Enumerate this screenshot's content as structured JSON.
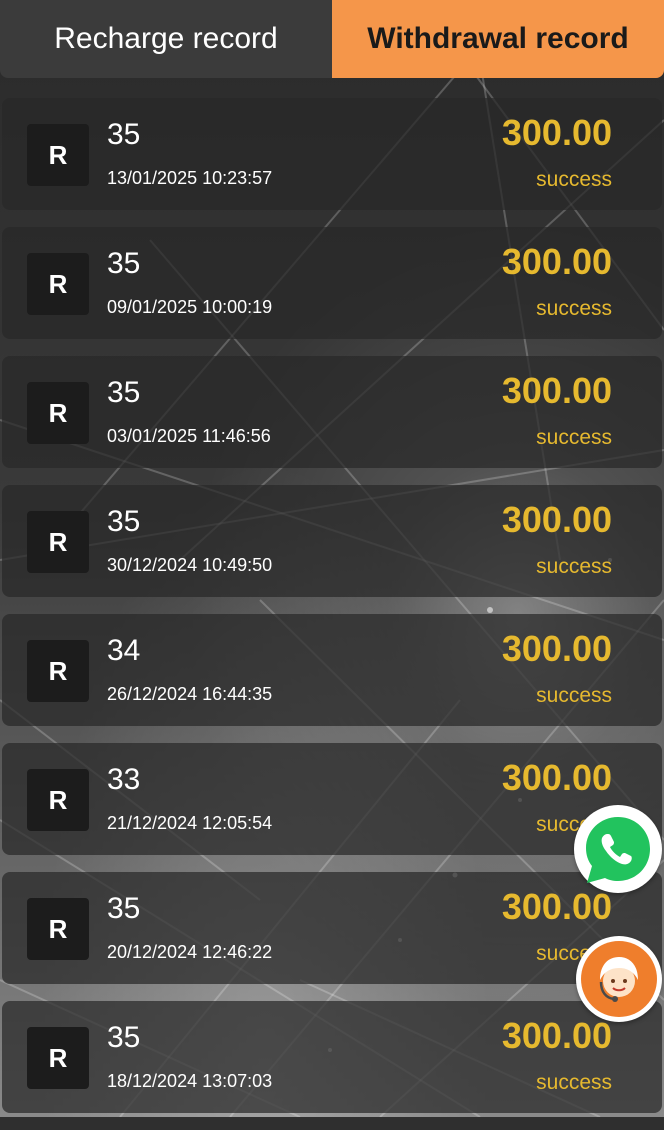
{
  "tabs": {
    "recharge_label": "Recharge record",
    "withdrawal_label": "Withdrawal record"
  },
  "records": [
    {
      "badge": "R",
      "number": "35",
      "datetime": "13/01/2025 10:23:57",
      "amount": "300.00",
      "status": "success"
    },
    {
      "badge": "R",
      "number": "35",
      "datetime": "09/01/2025 10:00:19",
      "amount": "300.00",
      "status": "success"
    },
    {
      "badge": "R",
      "number": "35",
      "datetime": "03/01/2025 11:46:56",
      "amount": "300.00",
      "status": "success"
    },
    {
      "badge": "R",
      "number": "35",
      "datetime": "30/12/2024 10:49:50",
      "amount": "300.00",
      "status": "success"
    },
    {
      "badge": "R",
      "number": "34",
      "datetime": "26/12/2024 16:44:35",
      "amount": "300.00",
      "status": "success"
    },
    {
      "badge": "R",
      "number": "33",
      "datetime": "21/12/2024 12:05:54",
      "amount": "300.00",
      "status": "success"
    },
    {
      "badge": "R",
      "number": "35",
      "datetime": "20/12/2024 12:46:22",
      "amount": "300.00",
      "status": "success"
    },
    {
      "badge": "R",
      "number": "35",
      "datetime": "18/12/2024 13:07:03",
      "amount": "300.00",
      "status": "success"
    }
  ],
  "floating": {
    "whatsapp_icon": "whatsapp-icon",
    "support_icon": "customer-support-icon"
  },
  "colors": {
    "accent": "#f5964a",
    "amount": "#e6b92f"
  }
}
